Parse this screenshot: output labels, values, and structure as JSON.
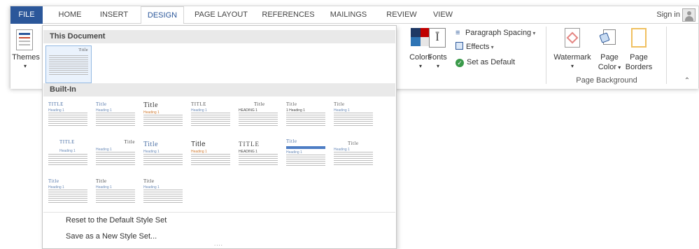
{
  "tabs": {
    "file": "FILE",
    "home": "HOME",
    "insert": "INSERT",
    "design": "DESIGN",
    "page_layout": "PAGE LAYOUT",
    "references": "REFERENCES",
    "mailings": "MAILINGS",
    "review": "REVIEW",
    "view": "VIEW"
  },
  "account": {
    "sign_in": "Sign in"
  },
  "ribbon": {
    "themes": "Themes",
    "colors": "Colors",
    "fonts": "Fonts",
    "paragraph_spacing": "Paragraph Spacing",
    "effects": "Effects",
    "set_as_default": "Set as Default",
    "watermark": "Watermark",
    "page_color_1": "Page",
    "page_color_2": "Color",
    "page_borders_1": "Page",
    "page_borders_2": "Borders",
    "page_background_label": "Page Background"
  },
  "gallery": {
    "this_document": "This Document",
    "built_in": "Built-In",
    "doc_thumb_title": "Title",
    "thumbs": [
      {
        "title": "TITLE",
        "heading": "Heading 1"
      },
      {
        "title": "Title",
        "heading": "Heading 1"
      },
      {
        "title": "Title",
        "heading": "Heading 1"
      },
      {
        "title": "TITLE",
        "heading": "Heading 1"
      },
      {
        "title": "Title",
        "heading": "HEADING 1"
      },
      {
        "title": "Title",
        "heading": "1 Heading 1"
      },
      {
        "title": "Title",
        "heading": "Heading 1"
      },
      {
        "title": "TITLE",
        "heading": "Heading 1"
      },
      {
        "title": "Title",
        "heading": "Heading 1"
      },
      {
        "title": "Title",
        "heading": "Heading 1"
      },
      {
        "title": "Title",
        "heading": "Heading 1"
      },
      {
        "title": "TITLE",
        "heading": "HEADING 1"
      },
      {
        "title": "Title",
        "heading": "Heading 1"
      },
      {
        "title": "Title",
        "heading": "Heading 1"
      },
      {
        "title": "Title",
        "heading": "Heading 1"
      },
      {
        "title": "Title",
        "heading": "Heading 1"
      },
      {
        "title": "Title",
        "heading": "Heading 1"
      }
    ],
    "reset_label": "Reset to the Default Style Set",
    "save_label": "Save as a New Style Set...",
    "grip": "...."
  },
  "colors": {
    "file_tab": "#2b579a",
    "accent_blue": "#2b579a",
    "thumb_blue": "#4a6fa5",
    "set_default_green": "#3a9a4a"
  },
  "icons": {
    "themes": "themes-icon",
    "colors": "color-palette-icon",
    "fonts": "fonts-icon",
    "paragraph_spacing": "paragraph-spacing-icon",
    "effects": "effects-icon",
    "set_as_default": "checkmark-circle-icon",
    "watermark": "watermark-icon",
    "page_color": "page-color-icon",
    "page_borders": "page-borders-icon",
    "collapse": "chevron-up-icon"
  }
}
